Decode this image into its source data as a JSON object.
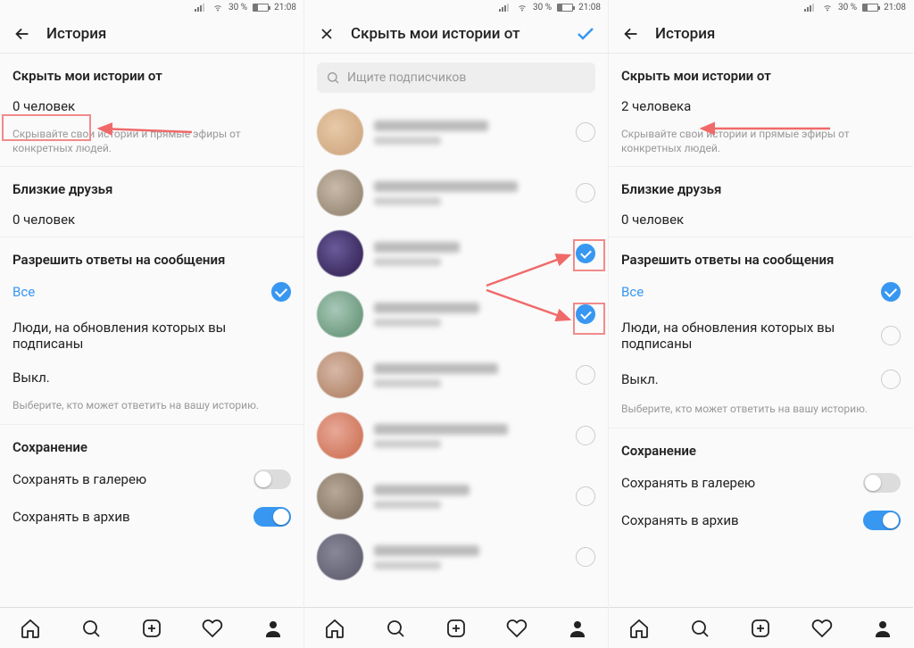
{
  "status": {
    "battery_pct": "30 %",
    "time": "21:08"
  },
  "panel1": {
    "title": "История",
    "hide_section": "Скрыть мои истории от",
    "hide_count": "0 человек",
    "hide_desc": "Скрывайте свои истории и прямые эфиры от конкретных людей.",
    "close_section": "Близкие друзья",
    "close_count": "0 человек",
    "reply_section": "Разрешить ответы на сообщения",
    "reply_all": "Все",
    "reply_follow": "Люди, на обновления которых вы подписаны",
    "reply_off": "Выкл.",
    "reply_desc": "Выберите, кто может ответить на вашу историю.",
    "save_section": "Сохранение",
    "save_gallery": "Сохранять в галерею",
    "save_archive": "Сохранять в архив"
  },
  "panel2": {
    "title": "Скрыть мои истории от",
    "search_placeholder": "Ищите подписчиков"
  },
  "panel3": {
    "title": "История",
    "hide_section": "Скрыть мои истории от",
    "hide_count": "2 человека",
    "hide_desc": "Скрывайте свои истории и прямые эфиры от конкретных людей.",
    "close_section": "Близкие друзья",
    "close_count": "0 человек",
    "reply_section": "Разрешить ответы на сообщения",
    "reply_all": "Все",
    "reply_follow": "Люди, на обновления которых вы подписаны",
    "reply_off": "Выкл.",
    "reply_desc": "Выберите, кто может ответить на вашу историю.",
    "save_section": "Сохранение",
    "save_gallery": "Сохранять в галерею",
    "save_archive": "Сохранять в архив"
  }
}
